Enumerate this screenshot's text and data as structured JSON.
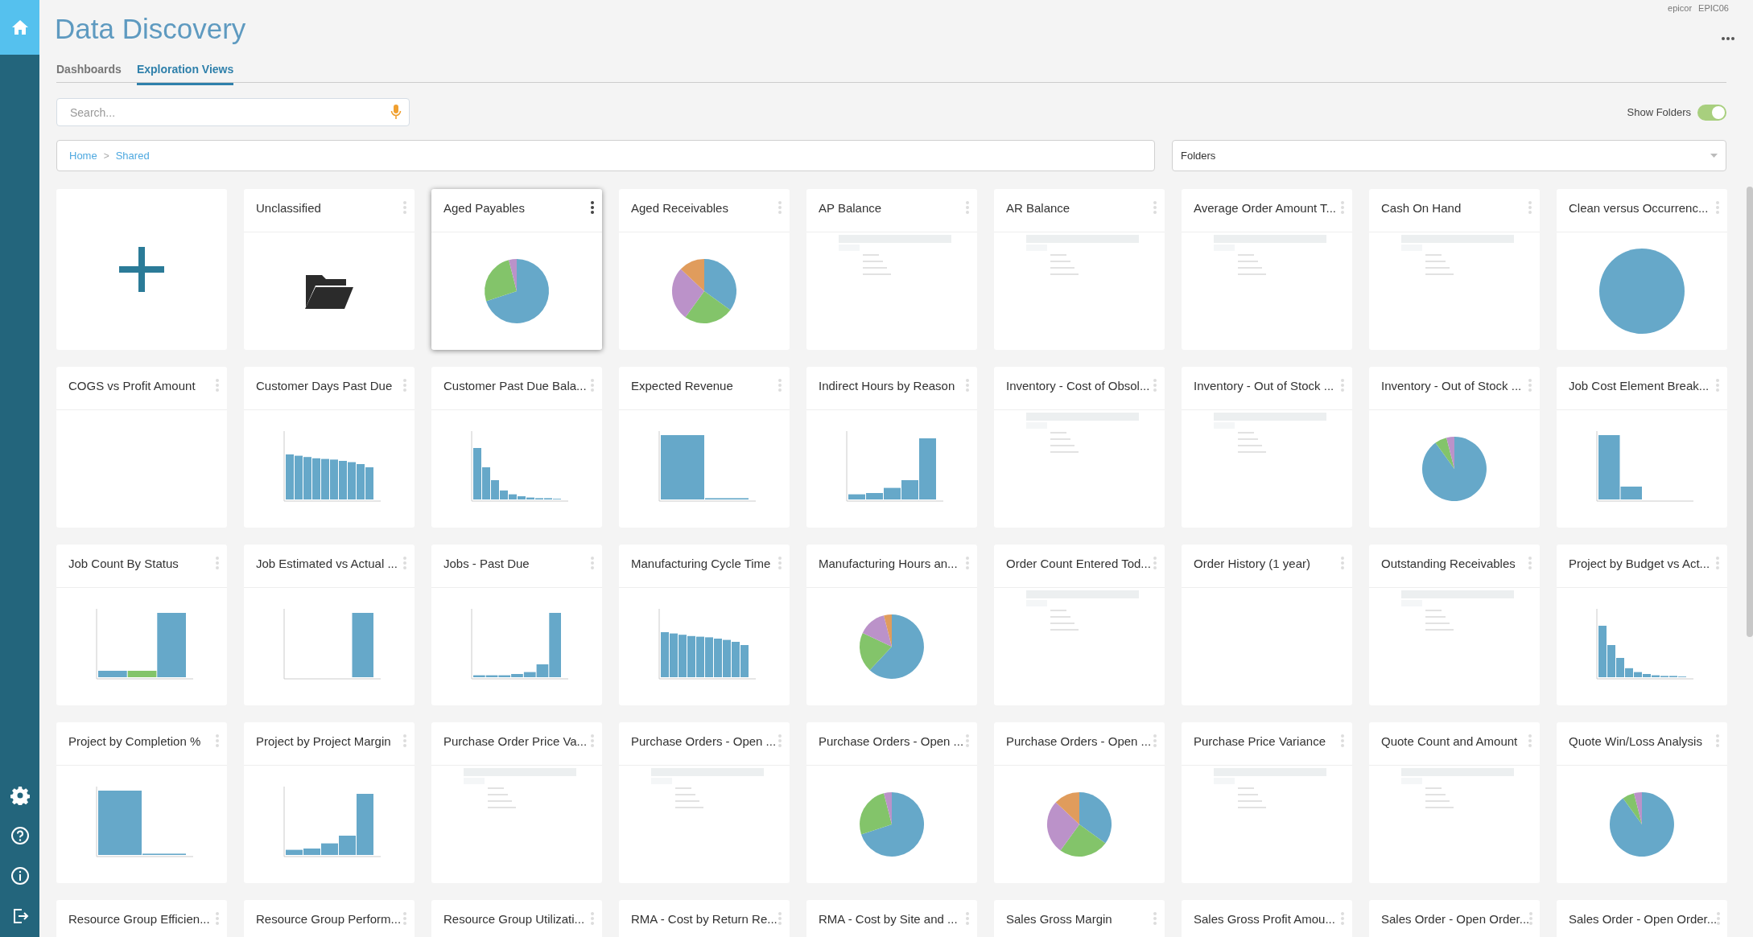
{
  "header": {
    "title": "Data Discovery",
    "user": "epicor",
    "company": "EPIC06"
  },
  "tabs": [
    {
      "label": "Dashboards",
      "selected": false
    },
    {
      "label": "Exploration Views",
      "selected": true
    }
  ],
  "search": {
    "placeholder": "Search..."
  },
  "show_folders": {
    "label": "Show Folders",
    "on": true
  },
  "breadcrumb": [
    "Home",
    "Shared"
  ],
  "breadcrumb_separator": ">",
  "folder_select": {
    "value": "Folders"
  },
  "tiles": [
    {
      "kind": "add",
      "selected": false
    },
    {
      "kind": "folder",
      "title": "Unclassified",
      "selected": false
    },
    {
      "kind": "pie",
      "title": "Aged Payables",
      "selected": true
    },
    {
      "kind": "pie",
      "title": "Aged Receivables",
      "selected": false
    },
    {
      "kind": "table",
      "title": "AP Balance",
      "selected": false
    },
    {
      "kind": "table",
      "title": "AR Balance",
      "selected": false
    },
    {
      "kind": "table",
      "title": "Average Order Amount T...",
      "selected": false
    },
    {
      "kind": "table",
      "title": "Cash On Hand",
      "selected": false
    },
    {
      "kind": "circle",
      "title": "Clean versus Occurrenc...",
      "selected": false
    },
    {
      "kind": "blank",
      "title": "COGS vs Profit Amount",
      "selected": false
    },
    {
      "kind": "bar",
      "title": "Customer Days Past Due",
      "selected": false
    },
    {
      "kind": "bar",
      "title": "Customer Past Due Bala...",
      "selected": false
    },
    {
      "kind": "bar",
      "title": "Expected Revenue",
      "selected": false
    },
    {
      "kind": "bar",
      "title": "Indirect Hours by Reason",
      "selected": false
    },
    {
      "kind": "table",
      "title": "Inventory - Cost of Obsol...",
      "selected": false
    },
    {
      "kind": "table",
      "title": "Inventory - Out of Stock ...",
      "selected": false
    },
    {
      "kind": "pie",
      "title": "Inventory - Out of Stock ...",
      "selected": false
    },
    {
      "kind": "bar",
      "title": "Job Cost Element Break...",
      "selected": false
    },
    {
      "kind": "bar",
      "title": "Job Count By Status",
      "selected": false
    },
    {
      "kind": "bar",
      "title": "Job Estimated vs Actual ...",
      "selected": false
    },
    {
      "kind": "bar",
      "title": "Jobs - Past Due",
      "selected": false
    },
    {
      "kind": "bar",
      "title": "Manufacturing Cycle Time",
      "selected": false
    },
    {
      "kind": "pie",
      "title": "Manufacturing Hours an...",
      "selected": false
    },
    {
      "kind": "table",
      "title": "Order Count Entered Tod...",
      "selected": false
    },
    {
      "kind": "blank",
      "title": "Order History (1 year)",
      "selected": false
    },
    {
      "kind": "table",
      "title": "Outstanding Receivables",
      "selected": false
    },
    {
      "kind": "bar",
      "title": "Project by Budget vs Act...",
      "selected": false
    },
    {
      "kind": "bar",
      "title": "Project by Completion %",
      "selected": false
    },
    {
      "kind": "bar",
      "title": "Project by Project Margin",
      "selected": false
    },
    {
      "kind": "table",
      "title": "Purchase Order Price Va...",
      "selected": false
    },
    {
      "kind": "table",
      "title": "Purchase Orders - Open ...",
      "selected": false
    },
    {
      "kind": "pie",
      "title": "Purchase Orders - Open ...",
      "selected": false
    },
    {
      "kind": "pie",
      "title": "Purchase Orders - Open ...",
      "selected": false
    },
    {
      "kind": "table",
      "title": "Purchase Price Variance",
      "selected": false
    },
    {
      "kind": "table",
      "title": "Quote Count and Amount",
      "selected": false
    },
    {
      "kind": "pie",
      "title": "Quote Win/Loss Analysis",
      "selected": false
    },
    {
      "kind": "blank",
      "title": "Resource Group Efficien...",
      "selected": false
    },
    {
      "kind": "blank",
      "title": "Resource Group Perform...",
      "selected": false
    },
    {
      "kind": "blank",
      "title": "Resource Group Utilizati...",
      "selected": false
    },
    {
      "kind": "blank",
      "title": "RMA - Cost by Return Re...",
      "selected": false
    },
    {
      "kind": "blank",
      "title": "RMA - Cost by Site and ...",
      "selected": false
    },
    {
      "kind": "blank",
      "title": "Sales Gross Margin",
      "selected": false
    },
    {
      "kind": "blank",
      "title": "Sales Gross Profit Amou...",
      "selected": false
    },
    {
      "kind": "blank",
      "title": "Sales Order - Open Order...",
      "selected": false
    },
    {
      "kind": "blank",
      "title": "Sales Order - Open Order...",
      "selected": false
    }
  ]
}
